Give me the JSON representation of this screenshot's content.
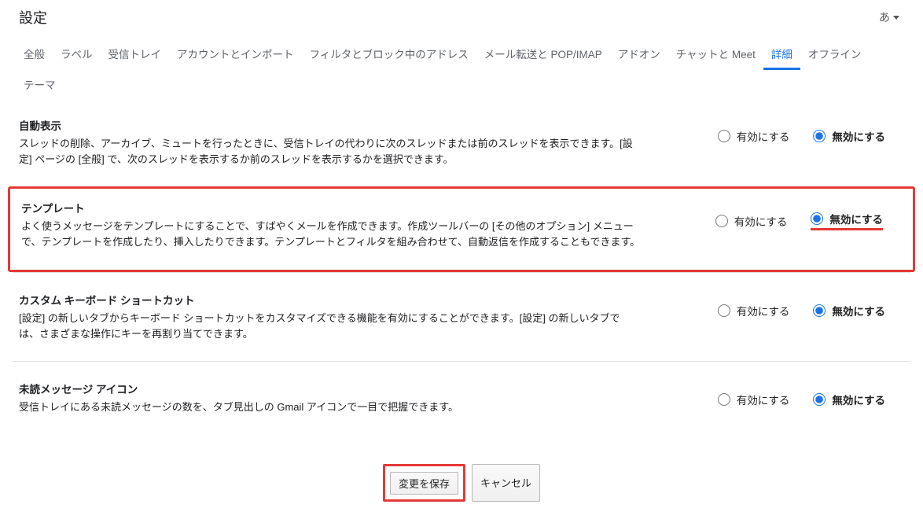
{
  "header": {
    "title": "設定",
    "lang": "あ"
  },
  "tabs": [
    {
      "label": "全般",
      "active": false
    },
    {
      "label": "ラベル",
      "active": false
    },
    {
      "label": "受信トレイ",
      "active": false
    },
    {
      "label": "アカウントとインポート",
      "active": false
    },
    {
      "label": "フィルタとブロック中のアドレス",
      "active": false
    },
    {
      "label": "メール転送と POP/IMAP",
      "active": false
    },
    {
      "label": "アドオン",
      "active": false
    },
    {
      "label": "チャットと Meet",
      "active": false
    },
    {
      "label": "詳細",
      "active": true
    },
    {
      "label": "オフライン",
      "active": false
    },
    {
      "label": "テーマ",
      "active": false
    }
  ],
  "options": {
    "enable": "有効にする",
    "disable": "無効にする"
  },
  "sections": [
    {
      "key": "auto-advance",
      "title": "自動表示",
      "desc": "スレッドの削除、アーカイブ、ミュートを行ったときに、受信トレイの代わりに次のスレッドまたは前のスレッドを表示できます。[設定] ページの [全般] で、次のスレッドを表示するか前のスレッドを表示するかを選択できます。",
      "selected": "disable",
      "highlight": false,
      "underlineDisable": false
    },
    {
      "key": "templates",
      "title": "テンプレート",
      "desc": "よく使うメッセージをテンプレートにすることで、すばやくメールを作成できます。作成ツールバーの [その他のオプション] メニューで、テンプレートを作成したり、挿入したりできます。テンプレートとフィルタを組み合わせて、自動返信を作成することもできます。",
      "selected": "disable",
      "highlight": true,
      "underlineDisable": true
    },
    {
      "key": "custom-shortcuts",
      "title": "カスタム キーボード ショートカット",
      "desc": "[設定] の新しいタブからキーボード ショートカットをカスタマイズできる機能を有効にすることができます。[設定] の新しいタブでは、さまざまな操作にキーを再割り当てできます。",
      "selected": "disable",
      "highlight": false,
      "underlineDisable": false
    },
    {
      "key": "unread-icon",
      "title": "未読メッセージ アイコン",
      "desc": "受信トレイにある未読メッセージの数を、タブ見出しの Gmail アイコンで一目で把握できます。",
      "selected": "disable",
      "highlight": false,
      "underlineDisable": false
    }
  ],
  "buttons": {
    "save": "変更を保存",
    "cancel": "キャンセル"
  },
  "annotation": {
    "boxColor": "#e53935"
  }
}
